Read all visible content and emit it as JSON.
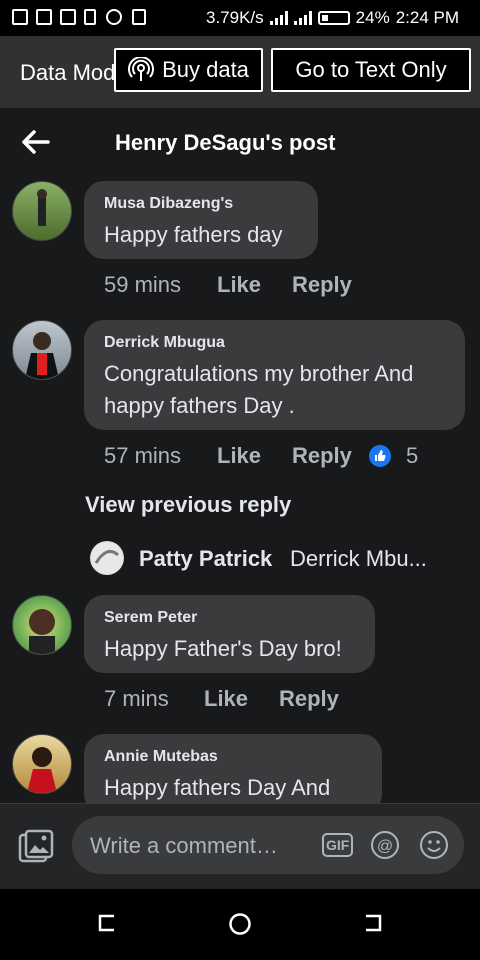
{
  "status_bar": {
    "speed": "3.79K/s",
    "battery": "24%",
    "time": "2:24 PM"
  },
  "banner": {
    "data_mode": "Data Mode",
    "buy_data": "Buy data",
    "text_only": "Go to Text Only"
  },
  "header": {
    "title": "Henry DeSagu's post"
  },
  "comments": [
    {
      "name": "Musa Dibazeng's",
      "text": "Happy fathers day",
      "time": "59 mins",
      "like": "Like",
      "reply": "Reply"
    },
    {
      "name": "Derrick Mbugua",
      "text": "Congratulations my brother And happy fathers Day .",
      "time": "57 mins",
      "like": "Like",
      "reply": "Reply",
      "reactions": "5"
    },
    {
      "name": "Serem Peter",
      "text": "Happy Father's Day bro!",
      "time": "7 mins",
      "like": "Like",
      "reply": "Reply"
    },
    {
      "name": "Annie Mutebas",
      "text": "Happy fathers Day And"
    }
  ],
  "view_previous": "View previous reply",
  "reply_preview": {
    "name": "Patty Patrick",
    "snippet": "Derrick Mbu..."
  },
  "composer": {
    "placeholder": "Write a comment…",
    "gif": "GIF"
  },
  "colors": {
    "background": "#18191a",
    "bubble": "#3a3b3c",
    "like_blue": "#1877f2"
  },
  "icons": [
    "back-arrow-icon",
    "photo-icon",
    "gif-icon",
    "mention-icon",
    "emoji-icon",
    "like-reaction-icon"
  ]
}
